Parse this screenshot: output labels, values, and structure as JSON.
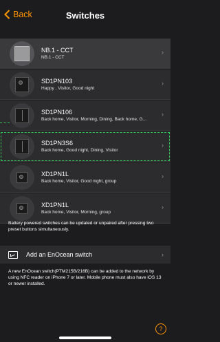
{
  "nav": {
    "back_label": "Back",
    "title": "Switches"
  },
  "switches": [
    {
      "name": "NB.1 - CCT",
      "sub": "NB.1 - CCT",
      "icon": "panel-light-icon"
    },
    {
      "name": "SD1PN103",
      "sub": "Happy , Visitor, Good night",
      "icon": "switch-icon"
    },
    {
      "name": "SD1PN106",
      "sub": "Back home, Visitor, Morning, Dining, Back home, G...",
      "icon": "switch-icon"
    },
    {
      "name": "SD1PN3S6",
      "sub": "Back home, Good night, Dining, Visitor",
      "icon": "switch-icon"
    },
    {
      "name": "XD1PN1L",
      "sub": "Back home, Visitor, Good night, group",
      "icon": "switch-small-icon"
    },
    {
      "name": "XD1PN1L",
      "sub": "Back home, Visitor, Morning, group",
      "icon": "switch-small-icon"
    }
  ],
  "battery_note": "Battery powered switches can be updated or unpaired after pressing two preset buttons simultaneously.",
  "add_switch_label": "Add an EnOcean switch",
  "enocean_note": "A new EnOcean switch(PTM215B/216B) can be added to the network by using NFC reader on iPhone 7 or later. Mobile phone must also have iOS 13 or newer installed.",
  "help_label": "?",
  "colors": {
    "accent": "#ff9500",
    "selection": "#34c759",
    "background": "#1c1c1e",
    "row": "#2c2c2e"
  }
}
